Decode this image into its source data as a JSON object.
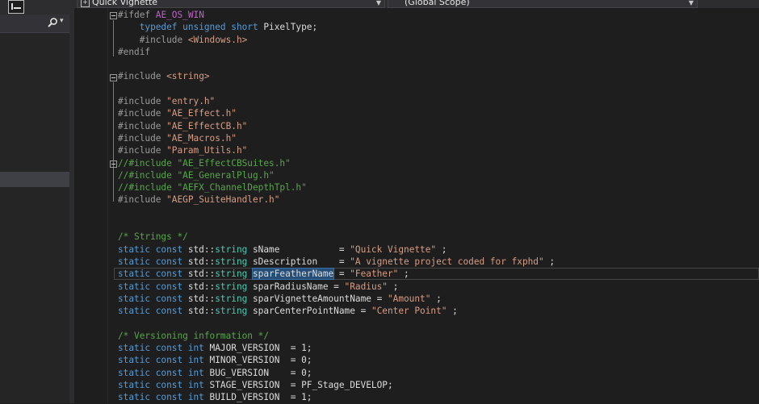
{
  "navbar": {
    "project_combo": "Quick Vignette",
    "scope_combo": "(Global Scope)"
  },
  "code_lines": [
    [
      {
        "t": "#ifdef ",
        "c": "pp"
      },
      {
        "t": "AE_OS_WIN",
        "c": "df"
      }
    ],
    [
      {
        "t": "    "
      },
      {
        "t": "typedef unsigned short ",
        "c": "kw"
      },
      {
        "t": "PixelType;"
      }
    ],
    [
      {
        "t": "    #include ",
        "c": "pp"
      },
      {
        "t": "<Windows.h>",
        "c": "str"
      }
    ],
    [
      {
        "t": "#endif",
        "c": "pp"
      }
    ],
    [],
    [
      {
        "t": "#include ",
        "c": "pp"
      },
      {
        "t": "<string>",
        "c": "str"
      }
    ],
    [],
    [
      {
        "t": "#include ",
        "c": "pp"
      },
      {
        "t": "\"entry.h\"",
        "c": "str"
      }
    ],
    [
      {
        "t": "#include ",
        "c": "pp"
      },
      {
        "t": "\"AE_Effect.h\"",
        "c": "str"
      }
    ],
    [
      {
        "t": "#include ",
        "c": "pp"
      },
      {
        "t": "\"AE_EffectCB.h\"",
        "c": "str"
      }
    ],
    [
      {
        "t": "#include ",
        "c": "pp"
      },
      {
        "t": "\"AE_Macros.h\"",
        "c": "str"
      }
    ],
    [
      {
        "t": "#include ",
        "c": "pp"
      },
      {
        "t": "\"Param_Utils.h\"",
        "c": "str"
      }
    ],
    [
      {
        "t": "//#include \"AE_EffectCBSuites.h\"",
        "c": "cm"
      }
    ],
    [
      {
        "t": "//#include \"AE_GeneralPlug.h\"",
        "c": "cm"
      }
    ],
    [
      {
        "t": "//#include \"AEFX_ChannelDepthTpl.h\"",
        "c": "cm"
      }
    ],
    [
      {
        "t": "#include ",
        "c": "pp"
      },
      {
        "t": "\"AEGP_SuiteHandler.h\"",
        "c": "str"
      }
    ],
    [],
    [],
    [
      {
        "t": "/* Strings */",
        "c": "cm"
      }
    ],
    [
      {
        "t": "static const ",
        "c": "kw"
      },
      {
        "t": "std::"
      },
      {
        "t": "string",
        "c": "ty"
      },
      {
        "t": " sName           = "
      },
      {
        "t": "\"Quick Vignette\"",
        "c": "str"
      },
      {
        "t": " ;"
      }
    ],
    [
      {
        "t": "static const ",
        "c": "kw"
      },
      {
        "t": "std::"
      },
      {
        "t": "string",
        "c": "ty"
      },
      {
        "t": " sDescription    = "
      },
      {
        "t": "\"A vignette project coded for fxphd\"",
        "c": "str"
      },
      {
        "t": " ;"
      }
    ],
    [
      {
        "t": "static const ",
        "c": "kw"
      },
      {
        "t": "std::"
      },
      {
        "t": "string",
        "c": "ty"
      },
      {
        "t": " "
      },
      {
        "t": "sparFeatherName",
        "c": "hl"
      },
      {
        "t": " = "
      },
      {
        "t": "\"Feather\"",
        "c": "str"
      },
      {
        "t": " ;"
      }
    ],
    [
      {
        "t": "static const ",
        "c": "kw"
      },
      {
        "t": "std::"
      },
      {
        "t": "string",
        "c": "ty"
      },
      {
        "t": " sparRadiusName = "
      },
      {
        "t": "\"Radius\"",
        "c": "str"
      },
      {
        "t": " ;"
      }
    ],
    [
      {
        "t": "static const ",
        "c": "kw"
      },
      {
        "t": "std::"
      },
      {
        "t": "string",
        "c": "ty"
      },
      {
        "t": " sparVignetteAmountName = "
      },
      {
        "t": "\"Amount\"",
        "c": "str"
      },
      {
        "t": " ;"
      }
    ],
    [
      {
        "t": "static const ",
        "c": "kw"
      },
      {
        "t": "std::"
      },
      {
        "t": "string",
        "c": "ty"
      },
      {
        "t": " sparCenterPointName = "
      },
      {
        "t": "\"Center Point\"",
        "c": "str"
      },
      {
        "t": " ;"
      }
    ],
    [],
    [
      {
        "t": "/* Versioning information */",
        "c": "cm"
      }
    ],
    [
      {
        "t": "static const int ",
        "c": "kw"
      },
      {
        "t": "MAJOR_VERSION  = 1;"
      }
    ],
    [
      {
        "t": "static const int ",
        "c": "kw"
      },
      {
        "t": "MINOR_VERSION  = 0;"
      }
    ],
    [
      {
        "t": "static const int ",
        "c": "kw"
      },
      {
        "t": "BUG_VERSION    = 0;"
      }
    ],
    [
      {
        "t": "static const int ",
        "c": "kw"
      },
      {
        "t": "STAGE_VERSION  = PF_Stage_DEVELOP;"
      }
    ],
    [
      {
        "t": "static const int ",
        "c": "kw"
      },
      {
        "t": "BUILD_VERSION  = 1;"
      }
    ]
  ]
}
